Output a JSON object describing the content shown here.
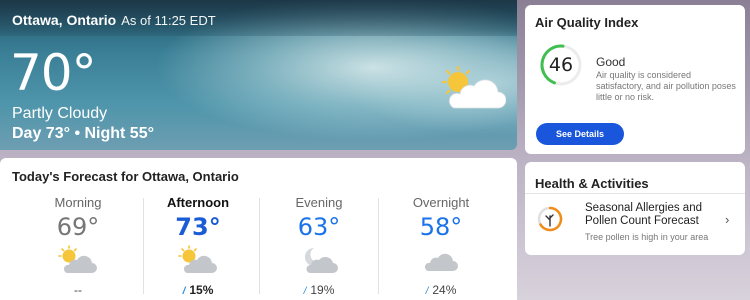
{
  "hero": {
    "city": "Ottawa, Ontario",
    "as_of": "As of 11:25 EDT",
    "temperature": "70°",
    "condition": "Partly Cloudy",
    "day_night": "Day 73° • Night 55°",
    "icon": "partly-cloudy-icon"
  },
  "forecast": {
    "title": "Today's Forecast for Ottawa, Ontario",
    "periods": [
      {
        "label": "Morning",
        "temp": "69°",
        "icon": "partly-cloudy-icon",
        "precip": "--"
      },
      {
        "label": "Afternoon",
        "temp": "73°",
        "icon": "partly-cloudy-icon",
        "precip": "15%"
      },
      {
        "label": "Evening",
        "temp": "63°",
        "icon": "partly-cloudy-night-icon",
        "precip": "19%"
      },
      {
        "label": "Overnight",
        "temp": "58°",
        "icon": "cloudy-icon",
        "precip": "24%"
      }
    ],
    "precip_icon": "raindrop-icon"
  },
  "aqi": {
    "title": "Air Quality Index",
    "value": "46",
    "level": 0.46,
    "status": "Good",
    "description": "Air quality is considered satisfactory, and air pollution poses little or no risk.",
    "button": "See Details",
    "accent": "#1a56db",
    "gauge_color": "#3fbf4f"
  },
  "health": {
    "title": "Health & Activities",
    "item_title": "Seasonal Allergies and Pollen Count Forecast",
    "item_sub": "Tree pollen is high in your area",
    "icon": "pollen-icon",
    "chevron": "›"
  }
}
